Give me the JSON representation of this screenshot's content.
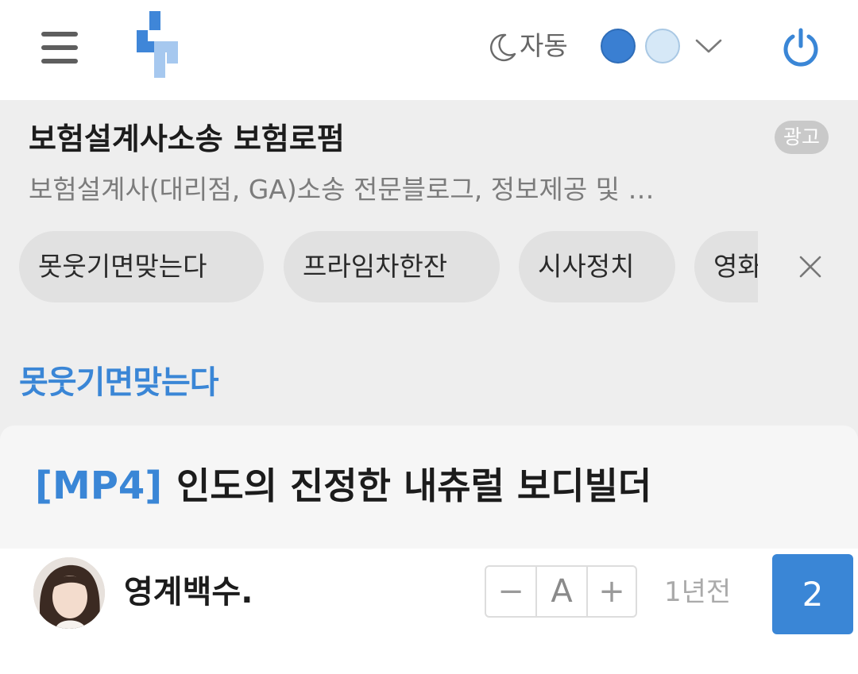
{
  "header": {
    "theme_label": "자동",
    "icons": {
      "menu": "hamburger-menu-icon",
      "logo": "site-logo",
      "theme": "moon-icon",
      "dropdown": "chevron-down-icon",
      "power": "power-icon"
    },
    "colors": {
      "dark_dot": "#3a7fd2",
      "light_dot": "#d6e8f7",
      "accent": "#3a86d6"
    }
  },
  "ad": {
    "title": "보험설계사소송 보험로펌",
    "badge": "광고",
    "description": "보험설계사(대리점, GA)소송 전문블로그, 정보제공 및 …"
  },
  "categories": {
    "items": [
      "못웃기면맞는다",
      "프라임차한잔",
      "시사정치",
      "영화"
    ]
  },
  "section": {
    "title": "못웃기면맞는다"
  },
  "post": {
    "tag": "[MP4]",
    "title": "인도의 진정한 내츄럴 보디빌더",
    "author": "영계백수.",
    "time": "1년전",
    "comment_count": "2",
    "font_controls": {
      "minus": "−",
      "size": "A",
      "plus": "+"
    }
  }
}
